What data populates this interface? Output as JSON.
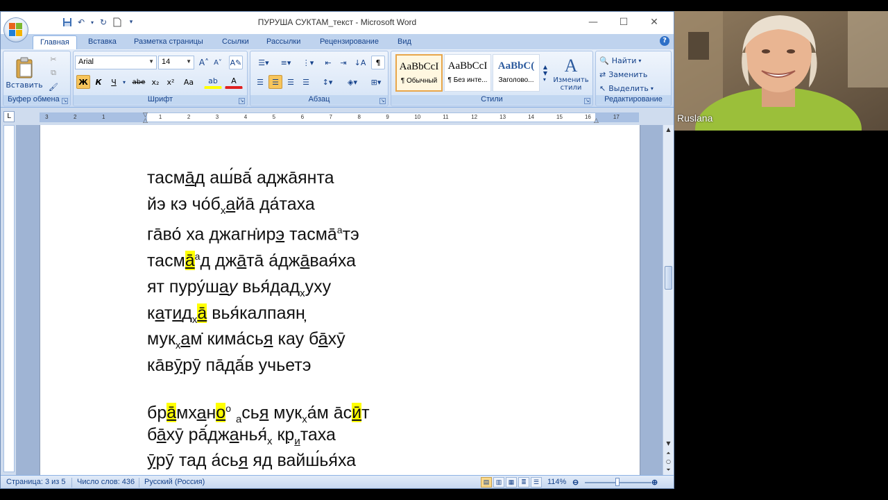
{
  "window": {
    "title": "ПУРУША СУКТАМ_текст - Microsoft Word",
    "controls": [
      "—",
      "☐",
      "✕"
    ]
  },
  "tabs": [
    {
      "label": "Главная",
      "active": true
    },
    {
      "label": "Вставка"
    },
    {
      "label": "Разметка страницы"
    },
    {
      "label": "Ссылки"
    },
    {
      "label": "Рассылки"
    },
    {
      "label": "Рецензирование"
    },
    {
      "label": "Вид"
    }
  ],
  "ribbon": {
    "clipboard": {
      "label": "Буфер обмена",
      "paste": "Вставить"
    },
    "font": {
      "label": "Шрифт",
      "family": "Arial",
      "size": "14",
      "bold": "Ж",
      "italic": "К",
      "underline": "Ч",
      "strike": "abe",
      "sub": "x₂",
      "sup": "x²",
      "case": "Aa",
      "grow": "A˄",
      "shrink": "A˅"
    },
    "paragraph": {
      "label": "Абзац",
      "pilcrow": "¶"
    },
    "styles": {
      "label": "Стили",
      "items": [
        {
          "sample": "AaBbCcI",
          "name": "¶ Обычный",
          "active": true
        },
        {
          "sample": "AaBbCcI",
          "name": "¶ Без инте..."
        },
        {
          "sample": "AaBbC(",
          "name": "Заголово..."
        }
      ],
      "change": "Изменить стили"
    },
    "editing": {
      "label": "Редактирование",
      "find": "Найти",
      "replace": "Заменить",
      "select": "Выделить"
    }
  },
  "ruler_ticks": [
    "3",
    "2",
    "1",
    "1",
    "2",
    "3",
    "4",
    "5",
    "6",
    "7",
    "8",
    "9",
    "10",
    "11",
    "12",
    "13",
    "14",
    "15",
    "16",
    "17"
  ],
  "document": {
    "stanzas": [
      [
        "тасма̄д аш́ва̄́ адж̄аянта",
        "йэ кэ чо́бхайа̄ да́таха",
        "га̄во́ ха джагн̇ирэ тасма̄ᵃтэ",
        "тасма̄ᵃд джа̄та̄ а́джа̄вайа́ха"
      ],
      [
        "ят пуру́шау вья́дадхуху",
        "катидха̄ вья́калпаян̦",
        "мукхам̇ кима́сья кау ба̄хӯ",
        "ка̄вӯрӯ па̄да̄́в учьетэ"
      ],
      [
        "бра̄мхано° ась́я мукха́м а̄сӣт",
        "ба̄хӯ ра̄́джанья́х кр̣итаха",
        "ӯрӯ тад а́сья яд вайш́ья́ха"
      ]
    ]
  },
  "status": {
    "page": "Страница: 3 из 5",
    "words": "Число слов: 436",
    "language": "Русский (Россия)",
    "zoom": "114%"
  },
  "webcam": {
    "name": "Ruslana"
  }
}
